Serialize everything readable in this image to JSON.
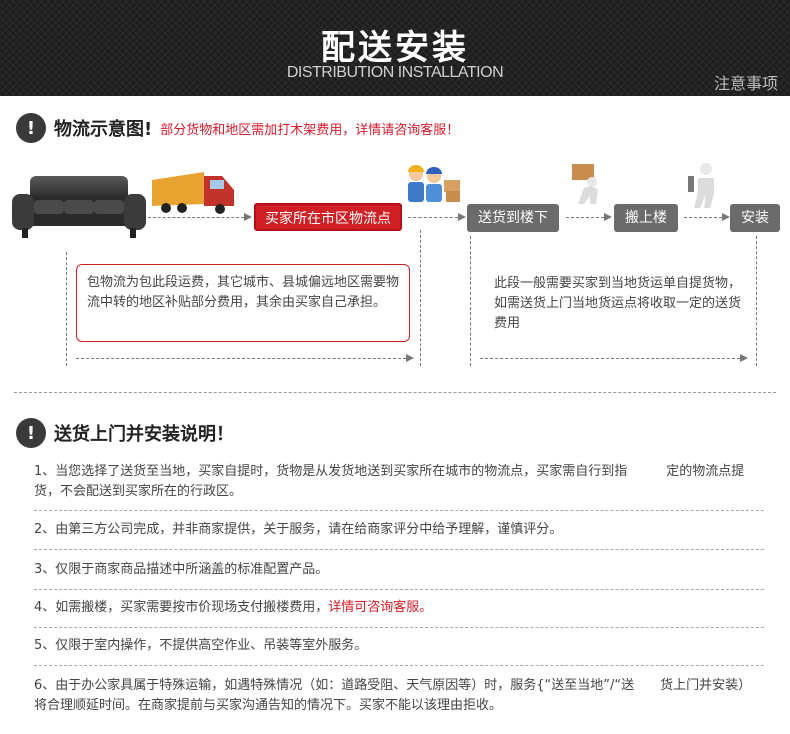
{
  "header": {
    "title": "配送安装",
    "subtitle": "DISTRIBUTION INSTALLATION",
    "note": "注意事项"
  },
  "logistics": {
    "icon": "!",
    "title": "物流示意图!",
    "note": "部分货物和地区需加打木架费用，详情请咨询客服！",
    "steps": [
      "买家所在市区物流点",
      "送货到楼下",
      "搬上楼",
      "安装"
    ],
    "left_box": "包物流为包此段运费，其它城市、县城偏远地区需要物流中转的地区补贴部分费用，其余由买家自己承担。",
    "right_box": "此段一般需要买家到当地货运单自提货物，如需送货上门当地货运点将收取一定的送货费用"
  },
  "install": {
    "icon": "!",
    "title": "送货上门并安装说明！",
    "items": [
      {
        "text": "1、当您选择了送货至当地，买家自提时，货物是从发货地送到买家所在城市的物流点，买家需自行到指　　　定的物流点提货，不会配送到买家所在的行政区。"
      },
      {
        "text": "2、由第三方公司完成，并非商家提供，关于服务，请在给商家评分中给予理解，谨慎评分。"
      },
      {
        "text": "3、仅限于商家商品描述中所涵盖的标准配置产品。"
      },
      {
        "text": "4、如需搬楼，买家需要按市价现场支付搬楼费用，",
        "highlight": "详情可咨询客服。"
      },
      {
        "text": "5、仅限于室内操作，不提供高空作业、吊装等室外服务。"
      },
      {
        "text": "6、由于办公家具属于特殊运输，如遇特殊情况（如：道路受阻、天气原因等）时，服务{“送至当地”/“送　　货上门并安装）将合理顺延时间。在商家提前与买家沟通告知的情况下。买家不能以该理由拒收。"
      }
    ]
  },
  "colors": {
    "accent": "#d11f26",
    "step_gray": "#6b6b6b",
    "header_bg": "#1d1d1d"
  }
}
